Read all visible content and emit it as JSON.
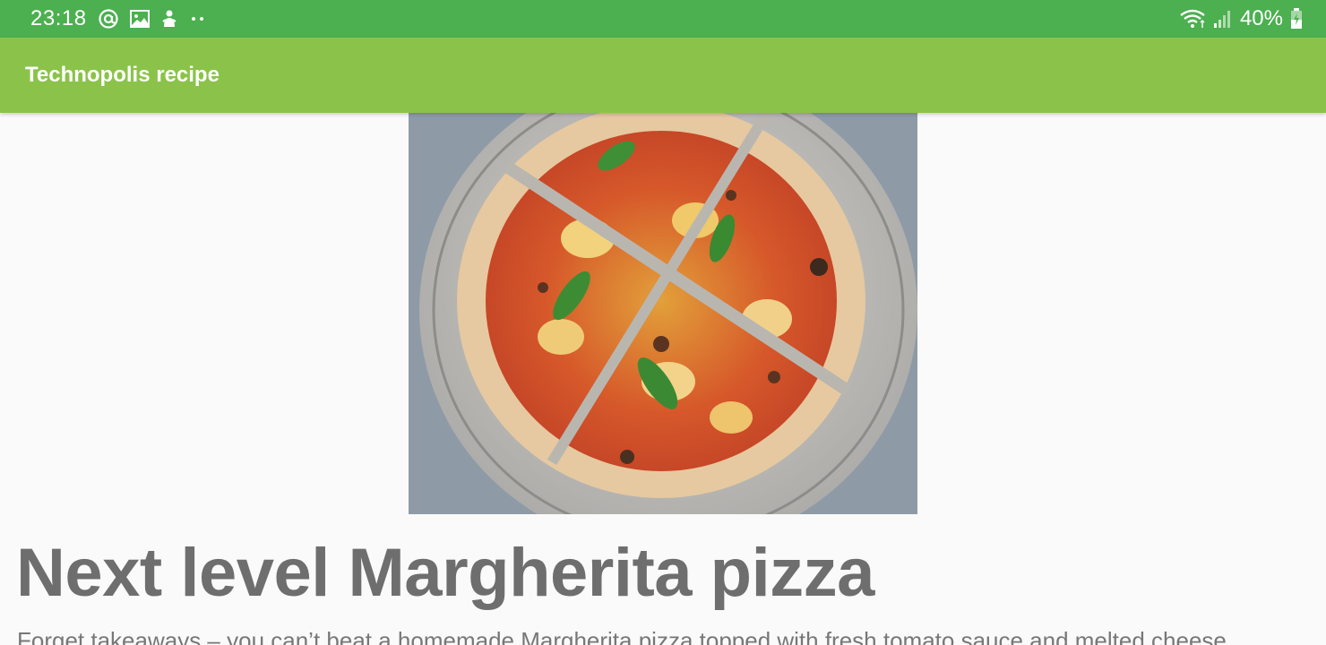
{
  "status_bar": {
    "time": "23:18",
    "left_icons": [
      "at-sign-icon",
      "gallery-icon",
      "mascot-notification-icon",
      "more-dots-icon"
    ],
    "right_icons": [
      "wifi-icon",
      "signal-icon",
      "battery-charging-icon"
    ],
    "battery": "40%"
  },
  "app_bar": {
    "title": "Technopolis recipe"
  },
  "recipe": {
    "image_icon": "pizza-photo",
    "title": "Next level Margherita pizza",
    "description": "Forget takeaways – you can’t beat a homemade Margherita pizza topped with fresh tomato sauce and melted cheese"
  },
  "colors": {
    "status_bar": "#4caf50",
    "app_bar": "#8bc34a",
    "background": "#fafafa",
    "title_text": "#6e6e6e"
  }
}
